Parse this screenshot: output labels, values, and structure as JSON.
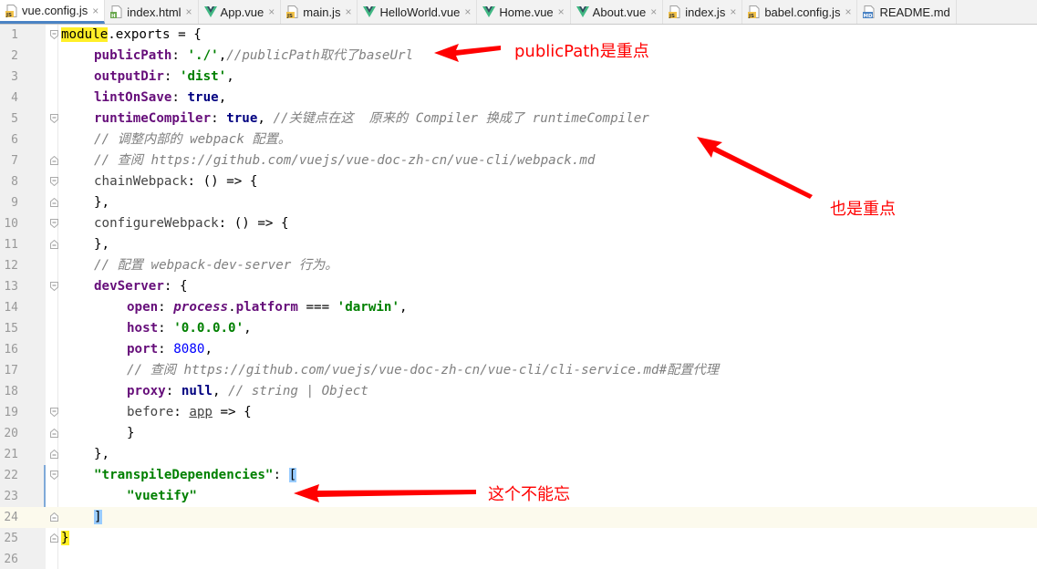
{
  "tabs": [
    {
      "label": "vue.config.js",
      "icon": "js-file-icon",
      "active": true
    },
    {
      "label": "index.html",
      "icon": "html-file-icon",
      "active": false
    },
    {
      "label": "App.vue",
      "icon": "vue-file-icon",
      "active": false
    },
    {
      "label": "main.js",
      "icon": "js-file-icon",
      "active": false
    },
    {
      "label": "HelloWorld.vue",
      "icon": "vue-file-icon",
      "active": false
    },
    {
      "label": "Home.vue",
      "icon": "vue-file-icon",
      "active": false
    },
    {
      "label": "About.vue",
      "icon": "vue-file-icon",
      "active": false
    },
    {
      "label": "index.js",
      "icon": "js-file-icon",
      "active": false
    },
    {
      "label": "babel.config.js",
      "icon": "js-file-icon",
      "active": false
    },
    {
      "label": "README.md",
      "icon": "md-file-icon",
      "active": false
    }
  ],
  "close_glyph": "×",
  "line_numbers": [
    "1",
    "2",
    "3",
    "4",
    "5",
    "6",
    "7",
    "8",
    "9",
    "10",
    "11",
    "12",
    "13",
    "14",
    "15",
    "16",
    "17",
    "18",
    "19",
    "20",
    "21",
    "22",
    "23",
    "24",
    "25",
    "26"
  ],
  "code": {
    "l1a": "module",
    "l1b": ".exports = {",
    "l2k": "publicPath",
    "l2c": ": ",
    "l2s": "'./'",
    "l2p": ",",
    "l2m": "//publicPath取代了baseUrl",
    "l3k": "outputDir",
    "l3c": ": ",
    "l3s": "'dist'",
    "l3p": ",",
    "l4k": "lintOnSave",
    "l4c": ": ",
    "l4v": "true",
    "l4p": ",",
    "l5k": "runtimeCompiler",
    "l5c": ": ",
    "l5v": "true",
    "l5p": ", ",
    "l5m": "//关键点在这  原来的 Compiler 换成了 runtimeCompiler",
    "l6m": "// 调整内部的 webpack 配置。",
    "l7m": "// 查阅 ",
    "l7u": "https://github.com/vuejs/vue-doc-zh-cn/vue-cli/webpack.md",
    "l8a": "chainWebpack",
    "l8b": ": () => {",
    "l9": "},",
    "l10a": "configureWebpack",
    "l10b": ": () => {",
    "l11": "},",
    "l12m": "// 配置 webpack-dev-server 行为。",
    "l13k": "devServer",
    "l13b": ": {",
    "l14k": "open",
    "l14c": ": ",
    "l14i": "process",
    "l14d": ".",
    "l14p": "platform",
    "l14e": " === ",
    "l14s": "'darwin'",
    "l14f": ",",
    "l15k": "host",
    "l15c": ": ",
    "l15s": "'0.0.0.0'",
    "l15p": ",",
    "l16k": "port",
    "l16c": ": ",
    "l16n": "8080",
    "l16p": ",",
    "l17m": "// 查阅 ",
    "l17u": "https://github.com/vuejs/vue-doc-zh-cn/vue-cli/cli-service.md",
    "l17t": "#配置代理",
    "l18k": "proxy",
    "l18c": ": ",
    "l18v": "null",
    "l18p": ", ",
    "l18m": "// string | Object",
    "l19a": "before",
    "l19b": ": ",
    "l19u": "app",
    "l19c": " => {",
    "l20": "}",
    "l21": "},",
    "l22s": "\"transpileDependencies\"",
    "l22c": ": ",
    "l22b": "[",
    "l23s": "\"vuetify\"",
    "l24b": "]",
    "l25b": "}"
  },
  "annotations": {
    "a1": "publicPath是重点",
    "a2": "也是重点",
    "a3": "这个不能忘"
  },
  "colors": {
    "annotation": "#ff0000",
    "keyword": "#000080",
    "property": "#660e7a",
    "string": "#008000",
    "number": "#0000ff",
    "comment": "#808080",
    "active_tab_underline": "#4a83c4"
  }
}
